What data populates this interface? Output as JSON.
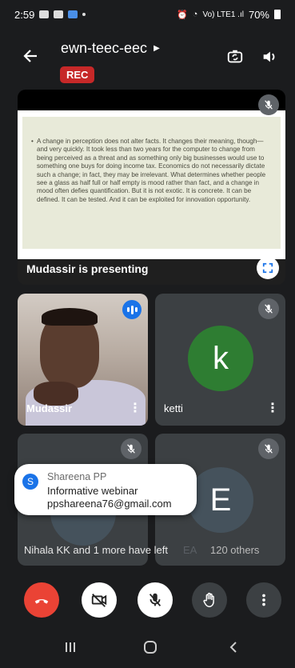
{
  "status_bar": {
    "time": "2:59",
    "network": "Vo) LTE1 .ıl",
    "battery": "70%"
  },
  "header": {
    "meeting_name": "ewn-teec-eec",
    "rec_badge": "REC"
  },
  "presentation": {
    "slide_text": "A change in perception does not alter facts. It changes their meaning, though—and very quickly. It took less than two years for the computer to change from being perceived as a threat and as something only big businesses would use to something one buys for doing income tax. Economics do not necessarily dictate such a change; in fact, they may be irrelevant. What determines whether people see a glass as half full or half empty is mood rather than fact, and a change in mood often defies quantification. But it is not exotic. It is concrete. It can be defined. It can be tested. And it can be exploited for innovation opportunity.",
    "label": "Mudassir is presenting"
  },
  "participants": [
    {
      "name": "Mudassir"
    },
    {
      "name": "ketti",
      "initial": "k",
      "color": "#2e7d32"
    },
    {
      "name": "",
      "initial": ""
    },
    {
      "name": "",
      "initial": "E",
      "color": "#45525c"
    }
  ],
  "tile_more": "⋮",
  "toast": {
    "avatar_initial": "S",
    "sender": "Shareena PP",
    "message_line1": "Informative webinar",
    "message_line2": "ppshareena76@gmail.com"
  },
  "footer": {
    "left_message": "Nihala KK and 1 more have left",
    "others_count": "120 others",
    "dim_label": "EA"
  },
  "colors": {
    "end_call": "#ea4335",
    "control_white": "#ffffff",
    "control_dark": "#3c4043",
    "accent_blue": "#1a73e8"
  }
}
